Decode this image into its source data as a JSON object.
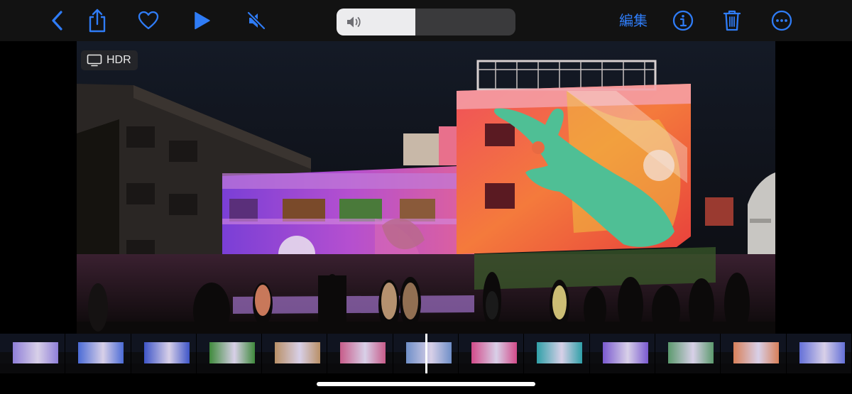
{
  "toolbar": {
    "icons": {
      "back": "chevron-left-icon",
      "share": "share-icon",
      "favorite": "heart-icon",
      "play": "play-icon",
      "mute": "speaker-muted-icon",
      "info": "info-icon",
      "delete": "trash-icon",
      "more": "ellipsis-circle-icon"
    },
    "edit_label": "編集",
    "volume_icon": "speaker-icon",
    "volume_level": 0.44
  },
  "video": {
    "hdr_label": "HDR",
    "hdr_icon": "display-icon"
  },
  "filmstrip": {
    "frame_count": 13,
    "playhead_position": 0.5,
    "frames": [
      {
        "color": "#8f7fd8"
      },
      {
        "color": "#4b6bd6"
      },
      {
        "color": "#3e55c8"
      },
      {
        "color": "#3f8a3c"
      },
      {
        "color": "#b99067"
      },
      {
        "color": "#c75c8a"
      },
      {
        "color": "#6f8fc8"
      },
      {
        "color": "#d24b8a"
      },
      {
        "color": "#2fa0a8"
      },
      {
        "color": "#7a5ad0"
      },
      {
        "color": "#5c9a6e"
      },
      {
        "color": "#d8805a"
      },
      {
        "color": "#6470d8"
      }
    ]
  },
  "colors": {
    "accent": "#2f7cf6",
    "toolbar_bg": "#121212"
  }
}
